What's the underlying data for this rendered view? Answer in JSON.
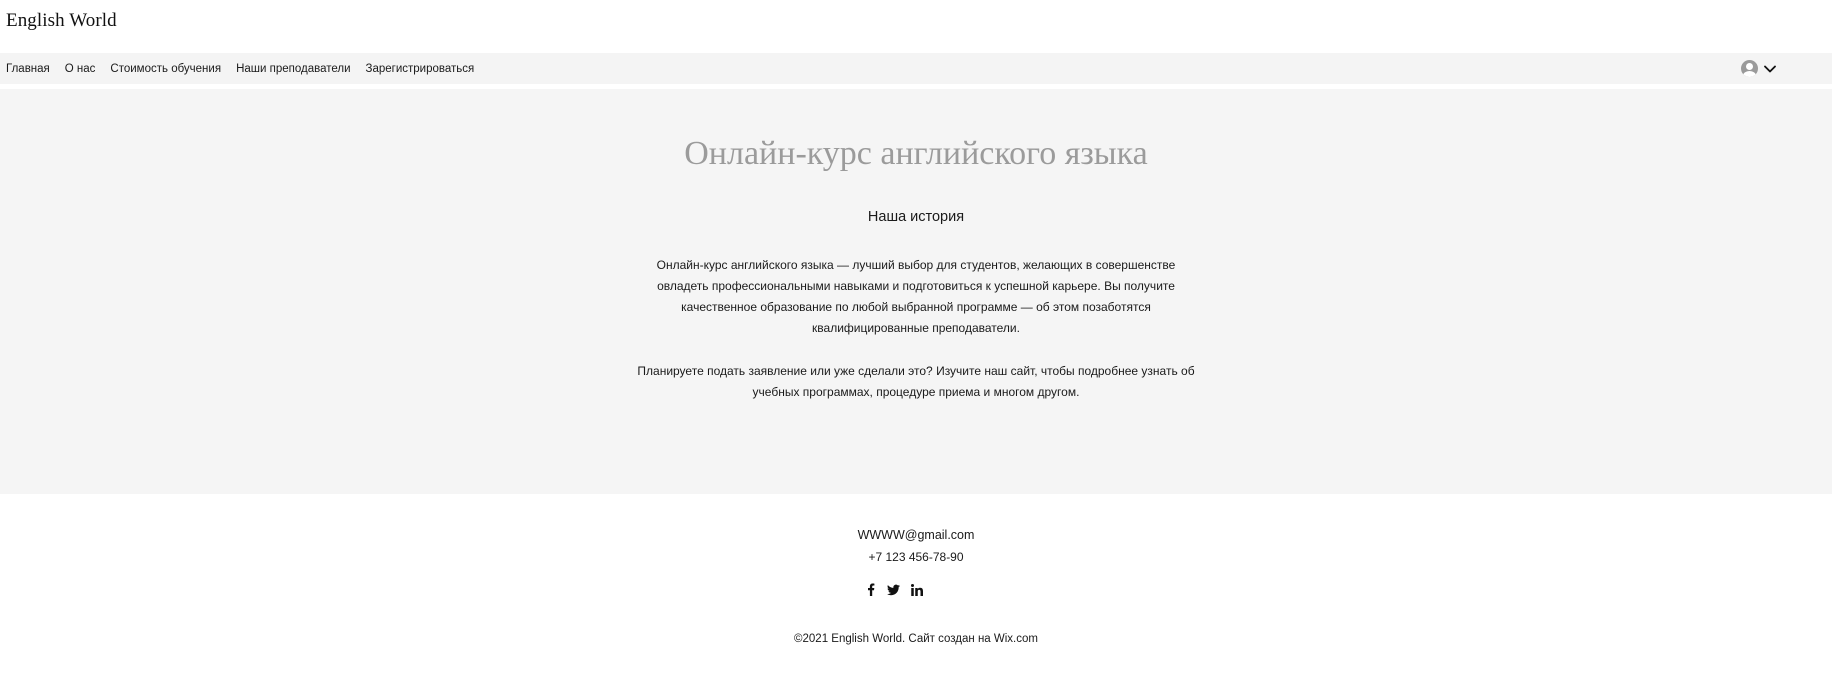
{
  "header": {
    "logo": "English World"
  },
  "nav": {
    "items": [
      {
        "label": "Главная"
      },
      {
        "label": "О нас"
      },
      {
        "label": "Стоимость обучения"
      },
      {
        "label": "Наши преподаватели"
      },
      {
        "label": "Зарегистрироваться"
      }
    ],
    "account_icon": "user-avatar-icon",
    "account_menu_icon": "chevron-down-icon"
  },
  "hero": {
    "title": "Онлайн-курс английского языка",
    "subtitle": "Наша история",
    "paragraph1_lines": [
      "Онлайн-курс английского языка — лучший выбор для студентов, желающих в совершенстве",
      "овладеть профессиональными навыками и подготовиться к успешной карьере. Вы получите",
      "качественное образование по любой выбранной программе — об этом позаботятся",
      "квалифицированные преподаватели."
    ],
    "paragraph2_lines": [
      "Планируете подать заявление или уже сделали это? Изучите наш сайт, чтобы подробнее узнать об",
      "учебных программах, процедуре приема и многом другом."
    ]
  },
  "footer": {
    "email": "WWWW@gmail.com",
    "phone": "+7 123 456-78-90",
    "social": [
      {
        "icon": "facebook-icon"
      },
      {
        "icon": "twitter-icon"
      },
      {
        "icon": "linkedin-icon"
      }
    ],
    "copyright": "©2021 English World. Сайт создан на Wix.com"
  },
  "colors": {
    "hero_background": "#f5f5f5",
    "nav_background": "#f4f4f4",
    "title_color": "#9b9b9b",
    "text_color": "#1a1a1a"
  }
}
